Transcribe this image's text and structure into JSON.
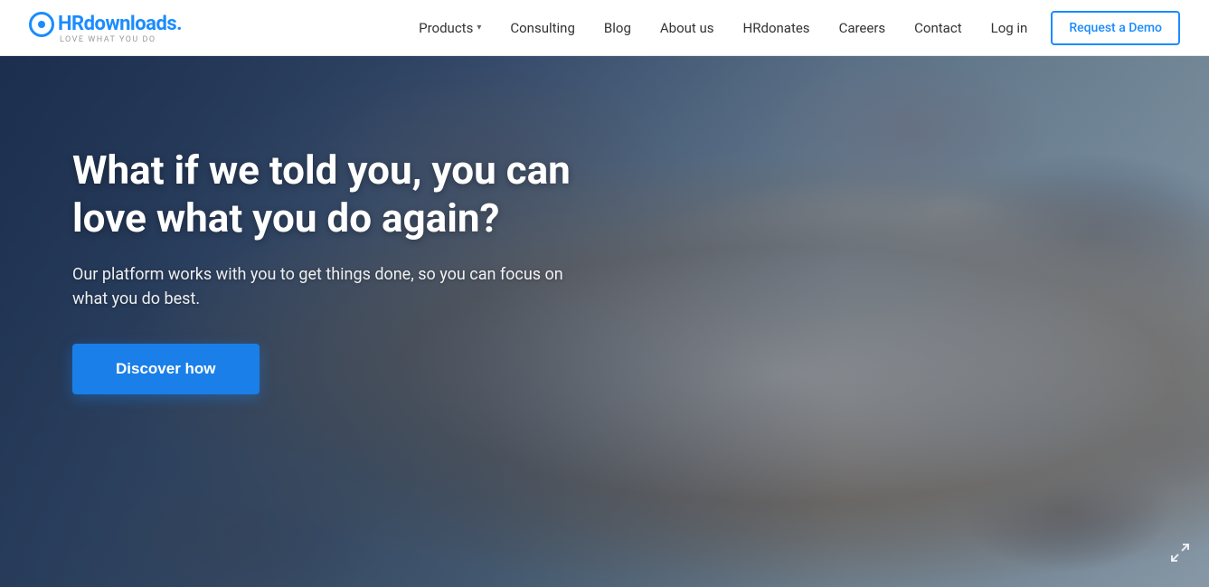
{
  "brand": {
    "name_prefix": "HR",
    "name_suffix": "downloads.",
    "tagline": "LOVE WHAT YOU DO"
  },
  "nav": {
    "items": [
      {
        "label": "Products",
        "has_dropdown": true
      },
      {
        "label": "Consulting",
        "has_dropdown": false
      },
      {
        "label": "Blog",
        "has_dropdown": false
      },
      {
        "label": "About us",
        "has_dropdown": false
      },
      {
        "label": "HRdonates",
        "has_dropdown": false
      },
      {
        "label": "Careers",
        "has_dropdown": false
      },
      {
        "label": "Contact",
        "has_dropdown": false
      }
    ],
    "login_label": "Log in",
    "demo_label": "Request a Demo"
  },
  "hero": {
    "headline": "What if we told you, you can love what you do again?",
    "subtext": "Our platform works with you to get things done, so you can focus on what you do best.",
    "cta_label": "Discover how"
  }
}
